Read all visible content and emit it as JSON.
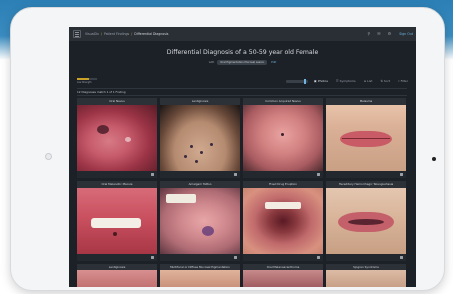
{
  "app": {
    "name": "VisualDx"
  },
  "breadcrumbs": [
    "VisualDx",
    "Patient Findings",
    "Differential Diagnosis"
  ],
  "topbar_icons": [
    "search-icon",
    "share-icon",
    "gear-icon"
  ],
  "signout_label": "Sign Out",
  "title": "Differential Diagnosis of a 50-59 year old Female",
  "subline": {
    "label": "with",
    "pill": "Oral Pigmentation Mucosal Lesion",
    "link": "Edit"
  },
  "progress": {
    "label": "Low Strength",
    "value": 0.6
  },
  "view_controls": [
    {
      "label": "Photos",
      "icon": "photo-icon",
      "active": true
    },
    {
      "label": "Symptoms",
      "icon": "symptoms-icon",
      "active": false
    },
    {
      "label": "List",
      "icon": "list-icon",
      "active": false
    },
    {
      "label": "Sort",
      "icon": "sort-icon",
      "active": false
    },
    {
      "label": "Filter",
      "icon": "filter-icon",
      "active": false
    }
  ],
  "count_text": "12 Diagnoses match 1 of 1 Finding",
  "cards": [
    {
      "title": "Oral Nevus"
    },
    {
      "title": "Lentiginosis"
    },
    {
      "title": "Common Acquired Nevus"
    },
    {
      "title": "Melasma"
    },
    {
      "title": "Oral Melanotic Macule"
    },
    {
      "title": "Amalgam Tattoo"
    },
    {
      "title": "Fixed Drug Eruption"
    },
    {
      "title": "Hereditary Hemorrhagic Telangiectasia"
    }
  ],
  "cards_row3": [
    {
      "title": "Lentiginosis"
    },
    {
      "title": "Multifocal or Diffuse Mucosal Pigmentation"
    },
    {
      "title": "Oral Melanoacanthoma"
    },
    {
      "title": "Sjogren Syndrome"
    }
  ]
}
